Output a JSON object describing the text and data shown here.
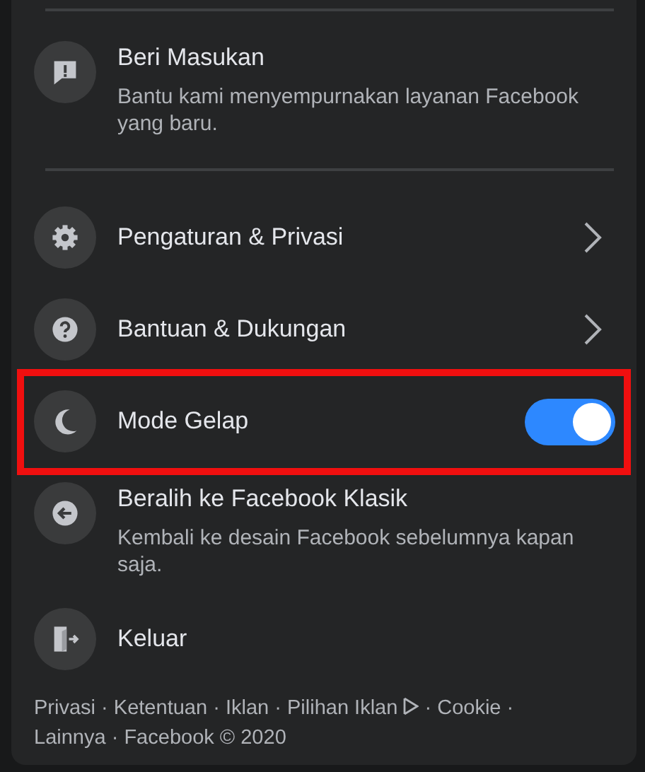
{
  "menu": {
    "rows": [
      {
        "kind": "described",
        "title": "Beri Masukan",
        "subtitle": "Bantu kami menyempurnakan layanan Facebook yang baru.",
        "highlighted": false,
        "divider_below": true
      },
      {
        "kind": "chevron",
        "title": "Pengaturan & Privasi",
        "highlighted": false
      },
      {
        "kind": "chevron",
        "title": "Bantuan & Dukungan",
        "highlighted": false
      },
      {
        "kind": "toggle",
        "title": "Mode Gelap",
        "on": true,
        "highlighted": true
      },
      {
        "kind": "described",
        "title": "Beralih ke Facebook Klasik",
        "subtitle": "Kembali ke desain Facebook sebelumnya kapan saja.",
        "highlighted": false
      },
      {
        "kind": "plain",
        "title": "Keluar",
        "highlighted": false
      }
    ]
  },
  "footer": {
    "separator": "·",
    "links": [
      {
        "label": "Privasi"
      },
      {
        "label": "Ketentuan"
      },
      {
        "label": "Iklan"
      },
      {
        "label": "Pilihan Iklan",
        "kind": "adchoices"
      },
      {
        "label": "Cookie"
      },
      {
        "label": "Lainnya"
      },
      {
        "label": "Facebook © 2020",
        "kind": "copyright"
      }
    ]
  }
}
